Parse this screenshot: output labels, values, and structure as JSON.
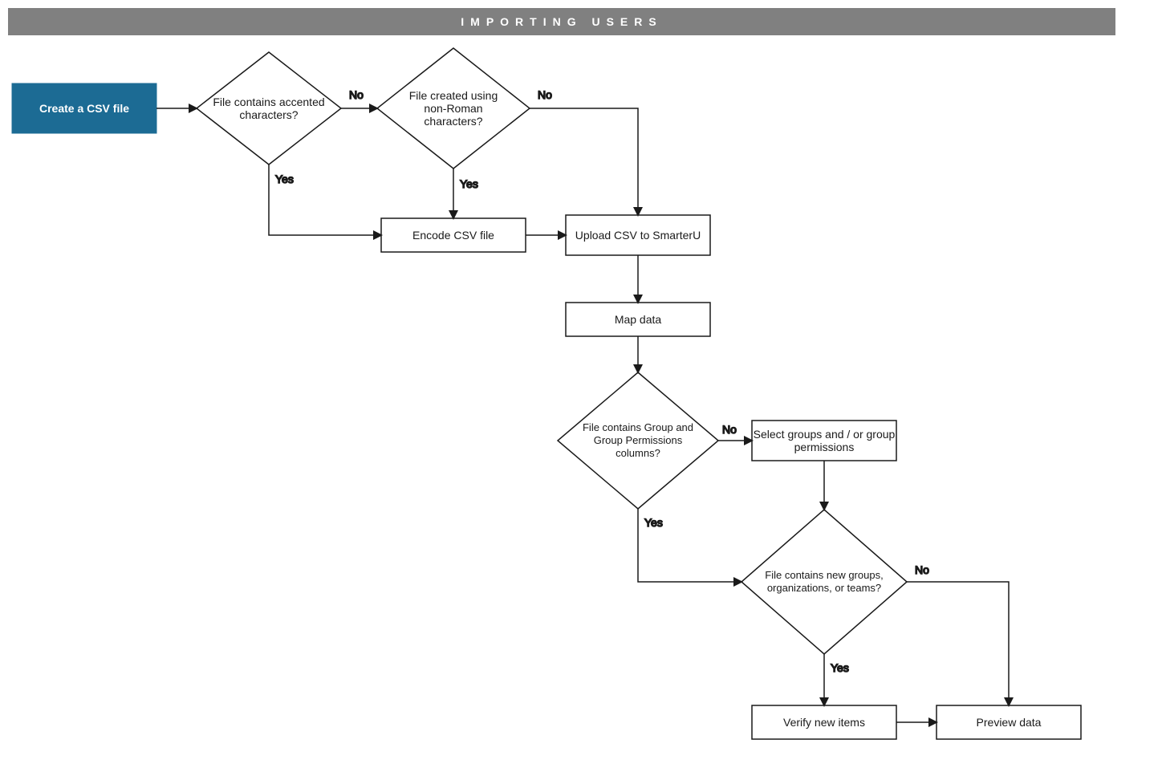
{
  "header": {
    "title": "IMPORTING USERS"
  },
  "nodes": {
    "start": {
      "label": "Create a CSV file"
    },
    "q_accented": {
      "label": "File contains accented characters?"
    },
    "q_nonroman": {
      "label": "File created using non-Roman characters?"
    },
    "encode": {
      "label": "Encode CSV file"
    },
    "upload": {
      "label": "Upload CSV to SmarterU"
    },
    "map": {
      "label": "Map data"
    },
    "q_groupcols": {
      "label": "File contains Group and Group Permissions columns?"
    },
    "selectgrp": {
      "label": "Select groups and / or group permissions"
    },
    "q_newitems": {
      "label": "File contains new groups, organizations, or teams?"
    },
    "verify": {
      "label": "Verify new items"
    },
    "preview": {
      "label": "Preview data"
    }
  },
  "edges": {
    "yes": "Yes",
    "no": "No"
  },
  "colors": {
    "start_fill": "#1c6b94",
    "stroke": "#1a1a1a",
    "header_bg": "#808080"
  }
}
